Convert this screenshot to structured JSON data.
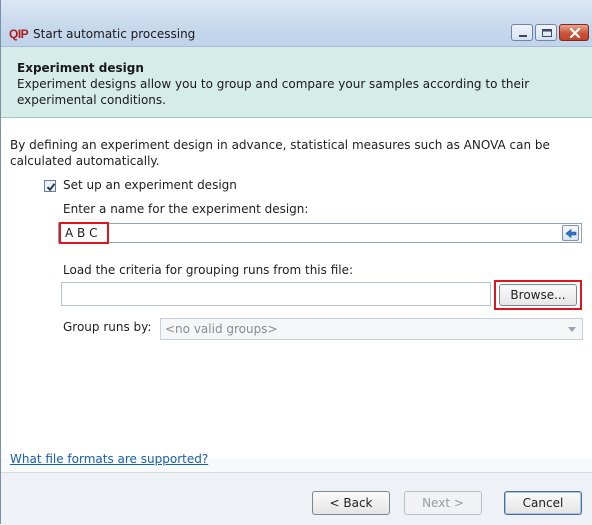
{
  "window": {
    "title": "Start automatic processing",
    "logo_text": "QIP"
  },
  "banner": {
    "title": "Experiment design",
    "description": "Experiment designs allow you to group and compare your samples according to their experimental conditions."
  },
  "form": {
    "intro": "By defining an experiment design in advance, statistical measures such as ANOVA can be calculated automatically.",
    "setup_checkbox": {
      "label": "Set up an experiment design",
      "checked": true
    },
    "name_label": "Enter a name for the experiment design:",
    "name_value": "A B C",
    "load_label": "Load the criteria for grouping runs from this file:",
    "file_value": "",
    "browse_label": "Browse...",
    "group_label": "Group runs by:",
    "group_value": "<no valid groups>"
  },
  "help_link": "What file formats are supported?",
  "footer": {
    "back_label": "< Back",
    "next_label": "Next >",
    "cancel_label": "Cancel"
  },
  "colors": {
    "banner_bg": "#d5ece8",
    "highlight": "#e0141b",
    "link": "#1a5fb4"
  }
}
